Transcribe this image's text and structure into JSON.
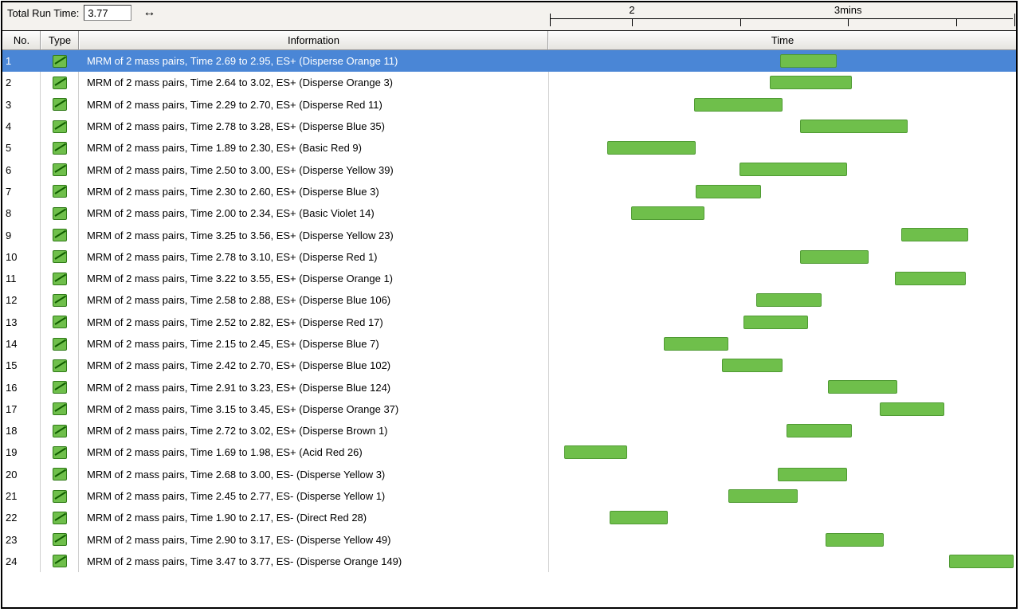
{
  "toolbar": {
    "run_time_label": "Total Run Time:",
    "run_time_value": "3.77"
  },
  "ruler": {
    "start": 1.62,
    "end": 3.77,
    "ticks": [
      {
        "value": 2.0,
        "label": "2",
        "major": true
      },
      {
        "value": 2.5,
        "label": "",
        "major": false
      },
      {
        "value": 3.0,
        "label": "3mins",
        "major": true
      },
      {
        "value": 3.5,
        "label": "",
        "major": false
      }
    ]
  },
  "columns": {
    "no": "No.",
    "type": "Type",
    "info": "Information",
    "time": "Time"
  },
  "selected_index": 0,
  "rows": [
    {
      "no": "1",
      "info": "MRM of 2 mass pairs, Time 2.69 to 2.95, ES+ (Disperse Orange 11)",
      "t0": 2.69,
      "t1": 2.95
    },
    {
      "no": "2",
      "info": "MRM of 2 mass pairs, Time 2.64 to 3.02, ES+ (Disperse Orange 3)",
      "t0": 2.64,
      "t1": 3.02
    },
    {
      "no": "3",
      "info": "MRM of 2 mass pairs, Time 2.29 to 2.70, ES+ (Disperse Red 11)",
      "t0": 2.29,
      "t1": 2.7
    },
    {
      "no": "4",
      "info": "MRM of 2 mass pairs, Time 2.78 to 3.28, ES+ (Disperse Blue 35)",
      "t0": 2.78,
      "t1": 3.28
    },
    {
      "no": "5",
      "info": "MRM of 2 mass pairs, Time 1.89 to 2.30, ES+ (Basic Red 9)",
      "t0": 1.89,
      "t1": 2.3
    },
    {
      "no": "6",
      "info": "MRM of 2 mass pairs, Time 2.50 to 3.00, ES+ (Disperse Yellow 39)",
      "t0": 2.5,
      "t1": 3.0
    },
    {
      "no": "7",
      "info": "MRM of 2 mass pairs, Time 2.30 to 2.60, ES+ (Disperse Blue 3)",
      "t0": 2.3,
      "t1": 2.6
    },
    {
      "no": "8",
      "info": "MRM of 2 mass pairs, Time 2.00 to 2.34, ES+ (Basic Violet 14)",
      "t0": 2.0,
      "t1": 2.34
    },
    {
      "no": "9",
      "info": "MRM of 2 mass pairs, Time 3.25 to 3.56, ES+ (Disperse Yellow 23)",
      "t0": 3.25,
      "t1": 3.56
    },
    {
      "no": "10",
      "info": "MRM of 2 mass pairs, Time 2.78 to 3.10, ES+ (Disperse Red 1)",
      "t0": 2.78,
      "t1": 3.1
    },
    {
      "no": "11",
      "info": "MRM of 2 mass pairs, Time 3.22 to 3.55, ES+ (Disperse Orange 1)",
      "t0": 3.22,
      "t1": 3.55
    },
    {
      "no": "12",
      "info": "MRM of 2 mass pairs, Time 2.58 to 2.88, ES+ (Disperse Blue 106)",
      "t0": 2.58,
      "t1": 2.88
    },
    {
      "no": "13",
      "info": "MRM of 2 mass pairs, Time 2.52 to 2.82, ES+ (Disperse Red 17)",
      "t0": 2.52,
      "t1": 2.82
    },
    {
      "no": "14",
      "info": "MRM of 2 mass pairs, Time 2.15 to 2.45, ES+ (Disperse Blue 7)",
      "t0": 2.15,
      "t1": 2.45
    },
    {
      "no": "15",
      "info": "MRM of 2 mass pairs, Time 2.42 to 2.70, ES+ (Disperse Blue 102)",
      "t0": 2.42,
      "t1": 2.7
    },
    {
      "no": "16",
      "info": "MRM of 2 mass pairs, Time 2.91 to 3.23, ES+ (Disperse Blue 124)",
      "t0": 2.91,
      "t1": 3.23
    },
    {
      "no": "17",
      "info": "MRM of 2 mass pairs, Time 3.15 to 3.45, ES+ (Disperse Orange 37)",
      "t0": 3.15,
      "t1": 3.45
    },
    {
      "no": "18",
      "info": "MRM of 2 mass pairs, Time 2.72 to 3.02, ES+ (Disperse Brown 1)",
      "t0": 2.72,
      "t1": 3.02
    },
    {
      "no": "19",
      "info": "MRM of 2 mass pairs, Time 1.69 to 1.98, ES+ (Acid Red 26)",
      "t0": 1.69,
      "t1": 1.98
    },
    {
      "no": "20",
      "info": "MRM of 2 mass pairs, Time 2.68 to 3.00, ES- (Disperse Yellow 3)",
      "t0": 2.68,
      "t1": 3.0
    },
    {
      "no": "21",
      "info": "MRM of 2 mass pairs, Time 2.45 to 2.77, ES- (Disperse Yellow 1)",
      "t0": 2.45,
      "t1": 2.77
    },
    {
      "no": "22",
      "info": "MRM of 2 mass pairs, Time 1.90 to 2.17, ES- (Direct Red 28)",
      "t0": 1.9,
      "t1": 2.17
    },
    {
      "no": "23",
      "info": "MRM of 2 mass pairs, Time 2.90 to 3.17, ES- (Disperse Yellow 49)",
      "t0": 2.9,
      "t1": 3.17
    },
    {
      "no": "24",
      "info": "MRM of 2 mass pairs, Time 3.47 to 3.77, ES- (Disperse Orange 149)",
      "t0": 3.47,
      "t1": 3.77
    }
  ]
}
